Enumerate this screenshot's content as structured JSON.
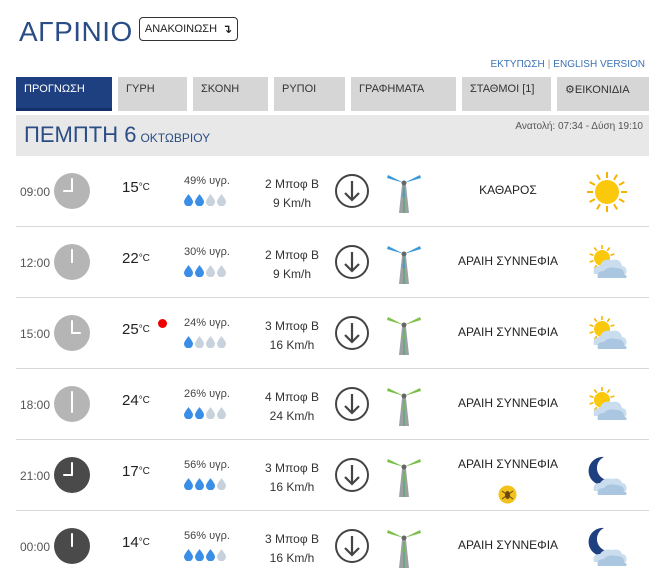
{
  "city": "ΑΓΡΙΝΙΟ",
  "announce_label": "ΑΝΑΚΟΙΝΩΣΗ",
  "announce_icon": "arrow-down-icon",
  "links": {
    "print": "ΕΚΤΥΠΩΣΗ",
    "separator": "|",
    "english": "ENGLISH VERSION"
  },
  "tabs": [
    {
      "label": "ΠΡΟΓΝΩΣΗ",
      "active": true
    },
    {
      "label": "ΓΥΡΗ"
    },
    {
      "label": "ΣΚΟΝΗ"
    },
    {
      "label": "ΡΥΠΟΙ"
    },
    {
      "label": "ΓΡΑΦΗΜΑΤΑ"
    },
    {
      "label": "ΣΤΑΘΜΟΙ [1]"
    },
    {
      "label": "ΕΙΚΟΝΙΔΙΑ",
      "icon": "gear-icon"
    }
  ],
  "day": {
    "name": "ΠΕΜΠΤΗ 6",
    "month": "ΟΚΤΩΒΡΙΟΥ",
    "sun": "Ανατολή: 07:34 - Δύση 19:10"
  },
  "colors": {
    "brand": "#1e3f80",
    "drop_active": "#3a8ee6",
    "drop_inactive": "#c8d2dc",
    "wind_blue": "#3a9ad9",
    "wind_green": "#7cc04a",
    "alert": "#e00000"
  },
  "rows": [
    {
      "time": "09:00",
      "clock": "light",
      "temp": "15",
      "unit": "°C",
      "alert": false,
      "hum": "49% υγρ.",
      "drops": 2,
      "bf": "2 Μποφ Β",
      "kmh": "9 Km/h",
      "turbine": "blue",
      "cond": "ΚΑΘΑΡΟΣ",
      "icon": "sun-icon"
    },
    {
      "time": "12:00",
      "clock": "light",
      "temp": "22",
      "unit": "°C",
      "alert": false,
      "hum": "30% υγρ.",
      "drops": 2,
      "bf": "2 Μποφ Β",
      "kmh": "9 Km/h",
      "turbine": "blue",
      "cond": "ΑΡΑΙΗ ΣΥΝΝΕΦΙΑ",
      "icon": "partly-cloudy-icon"
    },
    {
      "time": "15:00",
      "clock": "light",
      "temp": "25",
      "unit": "°C",
      "alert": true,
      "hum": "24% υγρ.",
      "drops": 1,
      "bf": "3 Μποφ Β",
      "kmh": "16 Km/h",
      "turbine": "green",
      "cond": "ΑΡΑΙΗ ΣΥΝΝΕΦΙΑ",
      "icon": "partly-cloudy-icon"
    },
    {
      "time": "18:00",
      "clock": "light",
      "temp": "24",
      "unit": "°C",
      "alert": false,
      "hum": "26% υγρ.",
      "drops": 2,
      "bf": "4 Μποφ Β",
      "kmh": "24 Km/h",
      "turbine": "green",
      "cond": "ΑΡΑΙΗ ΣΥΝΝΕΦΙΑ",
      "icon": "partly-cloudy-icon"
    },
    {
      "time": "21:00",
      "clock": "dark",
      "temp": "17",
      "unit": "°C",
      "alert": false,
      "hum": "56% υγρ.",
      "drops": 3,
      "bf": "3 Μποφ Β",
      "kmh": "16 Km/h",
      "turbine": "green",
      "cond": "ΑΡΑΙΗ ΣΥΝΝΕΦΙΑ",
      "icon": "moon-cloud-icon",
      "bug": true
    },
    {
      "time": "00:00",
      "clock": "dark",
      "temp": "14",
      "unit": "°C",
      "alert": false,
      "hum": "56% υγρ.",
      "drops": 3,
      "bf": "3 Μποφ Β",
      "kmh": "16 Km/h",
      "turbine": "green",
      "cond": "ΑΡΑΙΗ ΣΥΝΝΕΦΙΑ",
      "icon": "moon-cloud-icon"
    }
  ]
}
